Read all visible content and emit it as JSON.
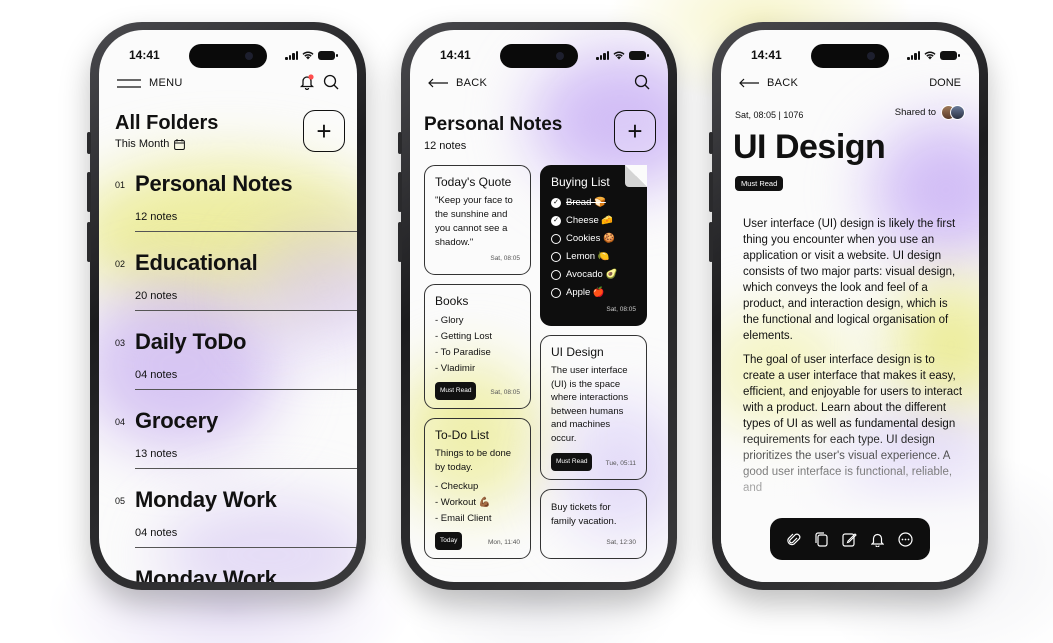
{
  "colors": {
    "accent_yellow": "#ecec8c",
    "accent_purple": "#c7b3ee",
    "dark": "#0e0e0e"
  },
  "status": {
    "time": "14:41"
  },
  "phone1": {
    "menu_label": "MENU",
    "title": "All Folders",
    "subtitle": "This Month",
    "add_label": "+",
    "folders": [
      {
        "num": "01",
        "name": "Personal Notes",
        "count": "12 notes"
      },
      {
        "num": "02",
        "name": "Educational",
        "count": "20 notes"
      },
      {
        "num": "03",
        "name": "Daily ToDo",
        "count": "04 notes"
      },
      {
        "num": "04",
        "name": "Grocery",
        "count": "13 notes"
      },
      {
        "num": "05",
        "name": "Monday Work",
        "count": "04 notes"
      },
      {
        "num": "",
        "name": "Monday Work",
        "count": ""
      }
    ]
  },
  "phone2": {
    "back_label": "BACK",
    "title": "Personal Notes",
    "subtitle": "12 notes",
    "add_label": "+",
    "quote": {
      "title": "Today's Quote",
      "text": "\"Keep your face to the sunshine and you cannot see a shadow.\"",
      "date": "Sat, 08:05"
    },
    "buying": {
      "title": "Buying List",
      "items": [
        {
          "label": "Bread 🍞",
          "done": true
        },
        {
          "label": "Cheese 🧀",
          "done": true
        },
        {
          "label": "Cookies 🍪",
          "done": false
        },
        {
          "label": "Lemon 🍋",
          "done": false
        },
        {
          "label": "Avocado 🥑",
          "done": false
        },
        {
          "label": "Apple 🍎",
          "done": false
        }
      ],
      "date": "Sat, 08:05"
    },
    "books": {
      "title": "Books",
      "items": [
        "- Glory",
        "- Getting Lost",
        "- To Paradise",
        "- Vladimir"
      ],
      "tag": "Must Read",
      "date": "Sat, 08:05"
    },
    "uidesign": {
      "title": "UI Design",
      "text": "The user interface (UI) is the space where interactions between humans and machines occur.",
      "tag": "Must Read",
      "date": "Tue, 05:11"
    },
    "todo": {
      "title": "To-Do List",
      "text": "Things to be done by today.",
      "items": [
        "- Checkup",
        "- Workout 💪🏾",
        "- Email Client"
      ],
      "tag": "Today",
      "date": "Mon, 11:40"
    },
    "tickets": {
      "text": "Buy tickets for family vacation.",
      "date": "Sat, 12:30"
    }
  },
  "phone3": {
    "back_label": "BACK",
    "done_label": "DONE",
    "meta": "Sat, 08:05 | 1076",
    "shared_label": "Shared to",
    "title": "UI Design",
    "tag": "Must Read",
    "para1": "User interface (UI) design is likely the first thing you encounter when you use an application or visit a website. UI design consists of two major parts: visual design, which conveys the look and feel of a product, and interaction design, which is the functional and logical organisation of elements.",
    "para2": "The goal of user interface design is to create a user interface that makes it easy, efficient, and enjoyable for users to interact with a product. Learn about the different types of UI as well as fundamental design requirements for each type. UI design prioritizes the user's visual experience. A good user interface is functional, reliable, and",
    "toolbar_icons": [
      "paperclip-icon",
      "copy-icon",
      "edit-icon",
      "bell-icon",
      "more-icon"
    ]
  }
}
